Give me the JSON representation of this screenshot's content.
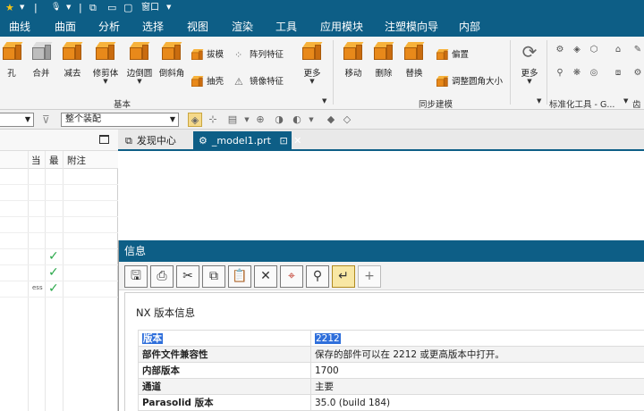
{
  "menu": {
    "items": [
      "曲线",
      "曲面",
      "分析",
      "选择",
      "视图",
      "渲染",
      "工具",
      "应用模块",
      "注塑模向导",
      "内部"
    ]
  },
  "titlebar": {
    "window_label": "窗口"
  },
  "ribbon": {
    "base_group": {
      "label": "基本",
      "buttons": [
        "孔",
        "合并",
        "减去",
        "修剪体",
        "边倒圆",
        "倒斜角",
        "更多"
      ],
      "small_tools": [
        "拔模",
        "抽壳",
        "阵列特征",
        "镜像特征"
      ]
    },
    "sync_group": {
      "label": "同步建模",
      "buttons": [
        "移动",
        "删除",
        "替换"
      ],
      "small_tools": [
        "偏置",
        "调整圆角大小"
      ]
    },
    "more_button": "更多",
    "std_parts_group": {
      "label": "标准化工具 - G..."
    },
    "gear_group": {
      "label": "齿轮"
    }
  },
  "selection_bar": {
    "assembly_filter": "整个装配"
  },
  "navigator": {
    "columns": [
      "当",
      "最",
      "附注"
    ],
    "row_marks": [
      false,
      false,
      false,
      false,
      false,
      true,
      true,
      true
    ],
    "row_small_text": "ess"
  },
  "tabs": [
    {
      "label": "发现中心",
      "active": false
    },
    {
      "label": "_model1.prt",
      "active": true
    }
  ],
  "info_dialog": {
    "title": "信息",
    "section_title": "NX 版本信息",
    "rows": [
      {
        "key": "版本",
        "value": "2212"
      },
      {
        "key": "部件文件兼容性",
        "value": "保存的部件可以在 2212 或更高版本中打开。"
      },
      {
        "key": "内部版本",
        "value": "1700"
      },
      {
        "key": "通道",
        "value": "主要"
      },
      {
        "key": "Parasolid 版本",
        "value": "35.0 (build 184)"
      }
    ]
  },
  "colors": {
    "accent": "#0d5e86",
    "check": "#2aa84a",
    "selection": "#2f6fdb"
  }
}
